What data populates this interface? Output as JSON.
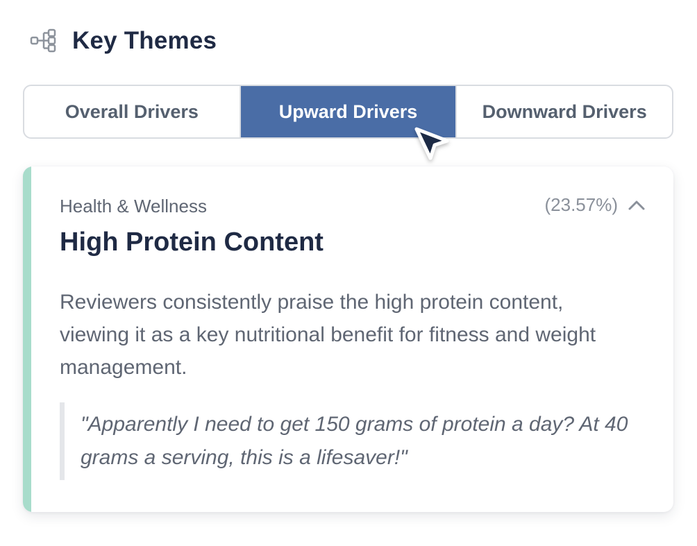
{
  "header": {
    "title": "Key Themes",
    "icon": "hierarchy-icon"
  },
  "tabs": [
    {
      "label": "Overall Drivers",
      "active": false
    },
    {
      "label": "Upward Drivers",
      "active": true
    },
    {
      "label": "Downward Drivers",
      "active": false
    }
  ],
  "theme_card": {
    "category": "Health & Wellness",
    "percentage": "(23.57%)",
    "title": "High Protein Content",
    "description": "Reviewers consistently praise the high protein content, viewing it as a key nutritional benefit for fitness and weight management.",
    "quote": "\"Apparently I need to get 150 grams of protein a day? At 40 grams a serving, this is a lifesaver!\"",
    "expanded": true
  },
  "colors": {
    "active_tab": "#4a6da6",
    "accent_bar": "#a8dccb",
    "title_text": "#1f2a44",
    "body_text": "#5f6673",
    "border": "#d9dce1"
  }
}
